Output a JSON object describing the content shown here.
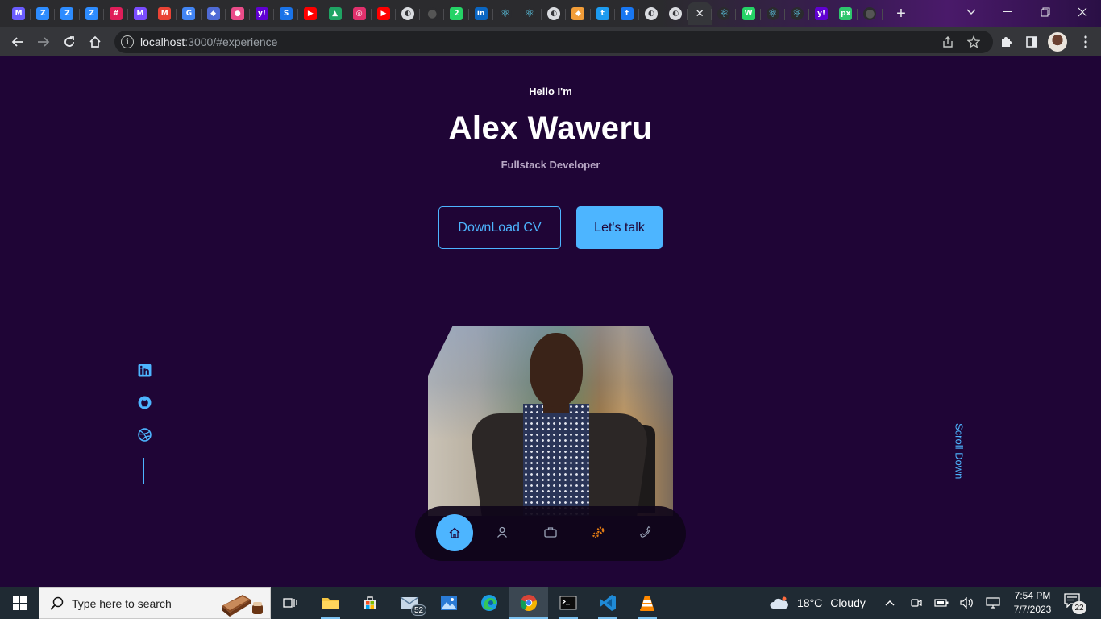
{
  "browser": {
    "tabs": [
      {
        "icon": "mural-icon",
        "glyph": "M",
        "color": "#6a5cff"
      },
      {
        "icon": "zoom-icon",
        "glyph": "Z",
        "color": "#2d8cff"
      },
      {
        "icon": "zoom-icon",
        "glyph": "Z",
        "color": "#2d8cff"
      },
      {
        "icon": "zoom-icon",
        "glyph": "Z",
        "color": "#2d8cff"
      },
      {
        "icon": "slack-icon",
        "glyph": "#",
        "color": "#e01e5a"
      },
      {
        "icon": "mural-icon",
        "glyph": "M",
        "color": "#7a4cff"
      },
      {
        "icon": "gmail-icon",
        "glyph": "M",
        "color": "#ea4335"
      },
      {
        "icon": "google-icon",
        "glyph": "G",
        "color": "#4285f4"
      },
      {
        "icon": "tab-icon",
        "glyph": "◆",
        "color": "#4f6bd6"
      },
      {
        "icon": "dribbble-icon",
        "glyph": "●",
        "color": "#ea4c89"
      },
      {
        "icon": "yahoo-icon",
        "glyph": "y!",
        "color": "#6001d2"
      },
      {
        "icon": "shazam-icon",
        "glyph": "S",
        "color": "#1a73e8"
      },
      {
        "icon": "youtube-icon",
        "glyph": "▶",
        "color": "#ff0000"
      },
      {
        "icon": "google-drive-icon",
        "glyph": "▲",
        "color": "#1fa463"
      },
      {
        "icon": "instagram-icon",
        "glyph": "◎",
        "color": "#e1306c"
      },
      {
        "icon": "youtube-icon",
        "glyph": "▶",
        "color": "#ff0000"
      },
      {
        "icon": "globe-icon",
        "glyph": "◐",
        "color": "#dadce0"
      },
      {
        "icon": "github-icon",
        "glyph": "●",
        "color": "#2b2b2e"
      },
      {
        "icon": "whatsapp-icon",
        "glyph": "2",
        "color": "#25d366"
      },
      {
        "icon": "linkedin-icon",
        "glyph": "in",
        "color": "#0a66c2"
      },
      {
        "icon": "react-icon",
        "glyph": "⚛",
        "color": "#2b2b2e"
      },
      {
        "icon": "react-icon",
        "glyph": "⚛",
        "color": "#2b2b2e"
      },
      {
        "icon": "globe-icon",
        "glyph": "◐",
        "color": "#dadce0"
      },
      {
        "icon": "tab-icon",
        "glyph": "◆",
        "color": "#f29d38"
      },
      {
        "icon": "twitter-icon",
        "glyph": "t",
        "color": "#1d9bf0"
      },
      {
        "icon": "facebook-icon",
        "glyph": "f",
        "color": "#1877f2"
      },
      {
        "icon": "globe-icon",
        "glyph": "◐",
        "color": "#dadce0"
      },
      {
        "icon": "globe-icon",
        "glyph": "◐",
        "color": "#dadce0"
      },
      {
        "icon": "close-icon",
        "glyph": "✕",
        "color": "#35363a",
        "active": true
      },
      {
        "icon": "react-icon",
        "glyph": "⚛",
        "color": "#2b2b2e"
      },
      {
        "icon": "whatsapp-icon",
        "glyph": "W",
        "color": "#25d366"
      },
      {
        "icon": "react-icon",
        "glyph": "⚛",
        "color": "#2b2b2e"
      },
      {
        "icon": "react-icon",
        "glyph": "⚛",
        "color": "#2b2b2e"
      },
      {
        "icon": "yahoo-icon",
        "glyph": "y!",
        "color": "#6001d2"
      },
      {
        "icon": "pixabay-icon",
        "glyph": "px",
        "color": "#2ec66d"
      },
      {
        "icon": "github-icon",
        "glyph": "●",
        "color": "#2b2b2e"
      }
    ],
    "url_host": "localhost",
    "url_rest": ":3000/#experience"
  },
  "page": {
    "greeting": "Hello I'm",
    "name": "Alex Waweru",
    "role": "Fullstack Developer",
    "download_cv": "DownLoad CV",
    "lets_talk": "Let's talk",
    "scroll_down": "Scroll Down",
    "accent": "#4db5ff",
    "background": "#1f0536"
  },
  "taskbar": {
    "search_placeholder": "Type here to search",
    "mail_badge": "52",
    "weather_temp": "18°C",
    "weather_desc": "Cloudy",
    "time": "7:54 PM",
    "date": "7/7/2023",
    "notifications": "22"
  }
}
